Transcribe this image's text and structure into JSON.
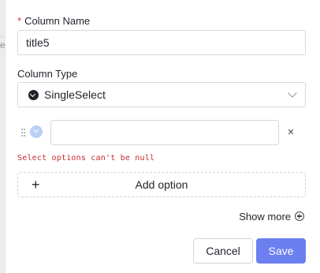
{
  "backdrop": {
    "edge_fragment": "e"
  },
  "form": {
    "column_name": {
      "required_mark": "*",
      "label": "Column Name",
      "value": "title5"
    },
    "column_type": {
      "label": "Column Type",
      "value": "SingleSelect",
      "icon": "single-select-icon"
    },
    "options": [
      {
        "value": "",
        "color": "#b9cff7"
      }
    ],
    "remove_option_symbol": "×",
    "error": "Select options can't be null",
    "add_option": {
      "symbol": "+",
      "label": "Add option"
    },
    "show_more": {
      "label": "Show more",
      "icon": "circle-plus-icon"
    }
  },
  "footer": {
    "cancel_label": "Cancel",
    "save_label": "Save"
  },
  "colors": {
    "accent": "#6b7ff0",
    "error": "#c92a2a",
    "required": "#e03131"
  }
}
